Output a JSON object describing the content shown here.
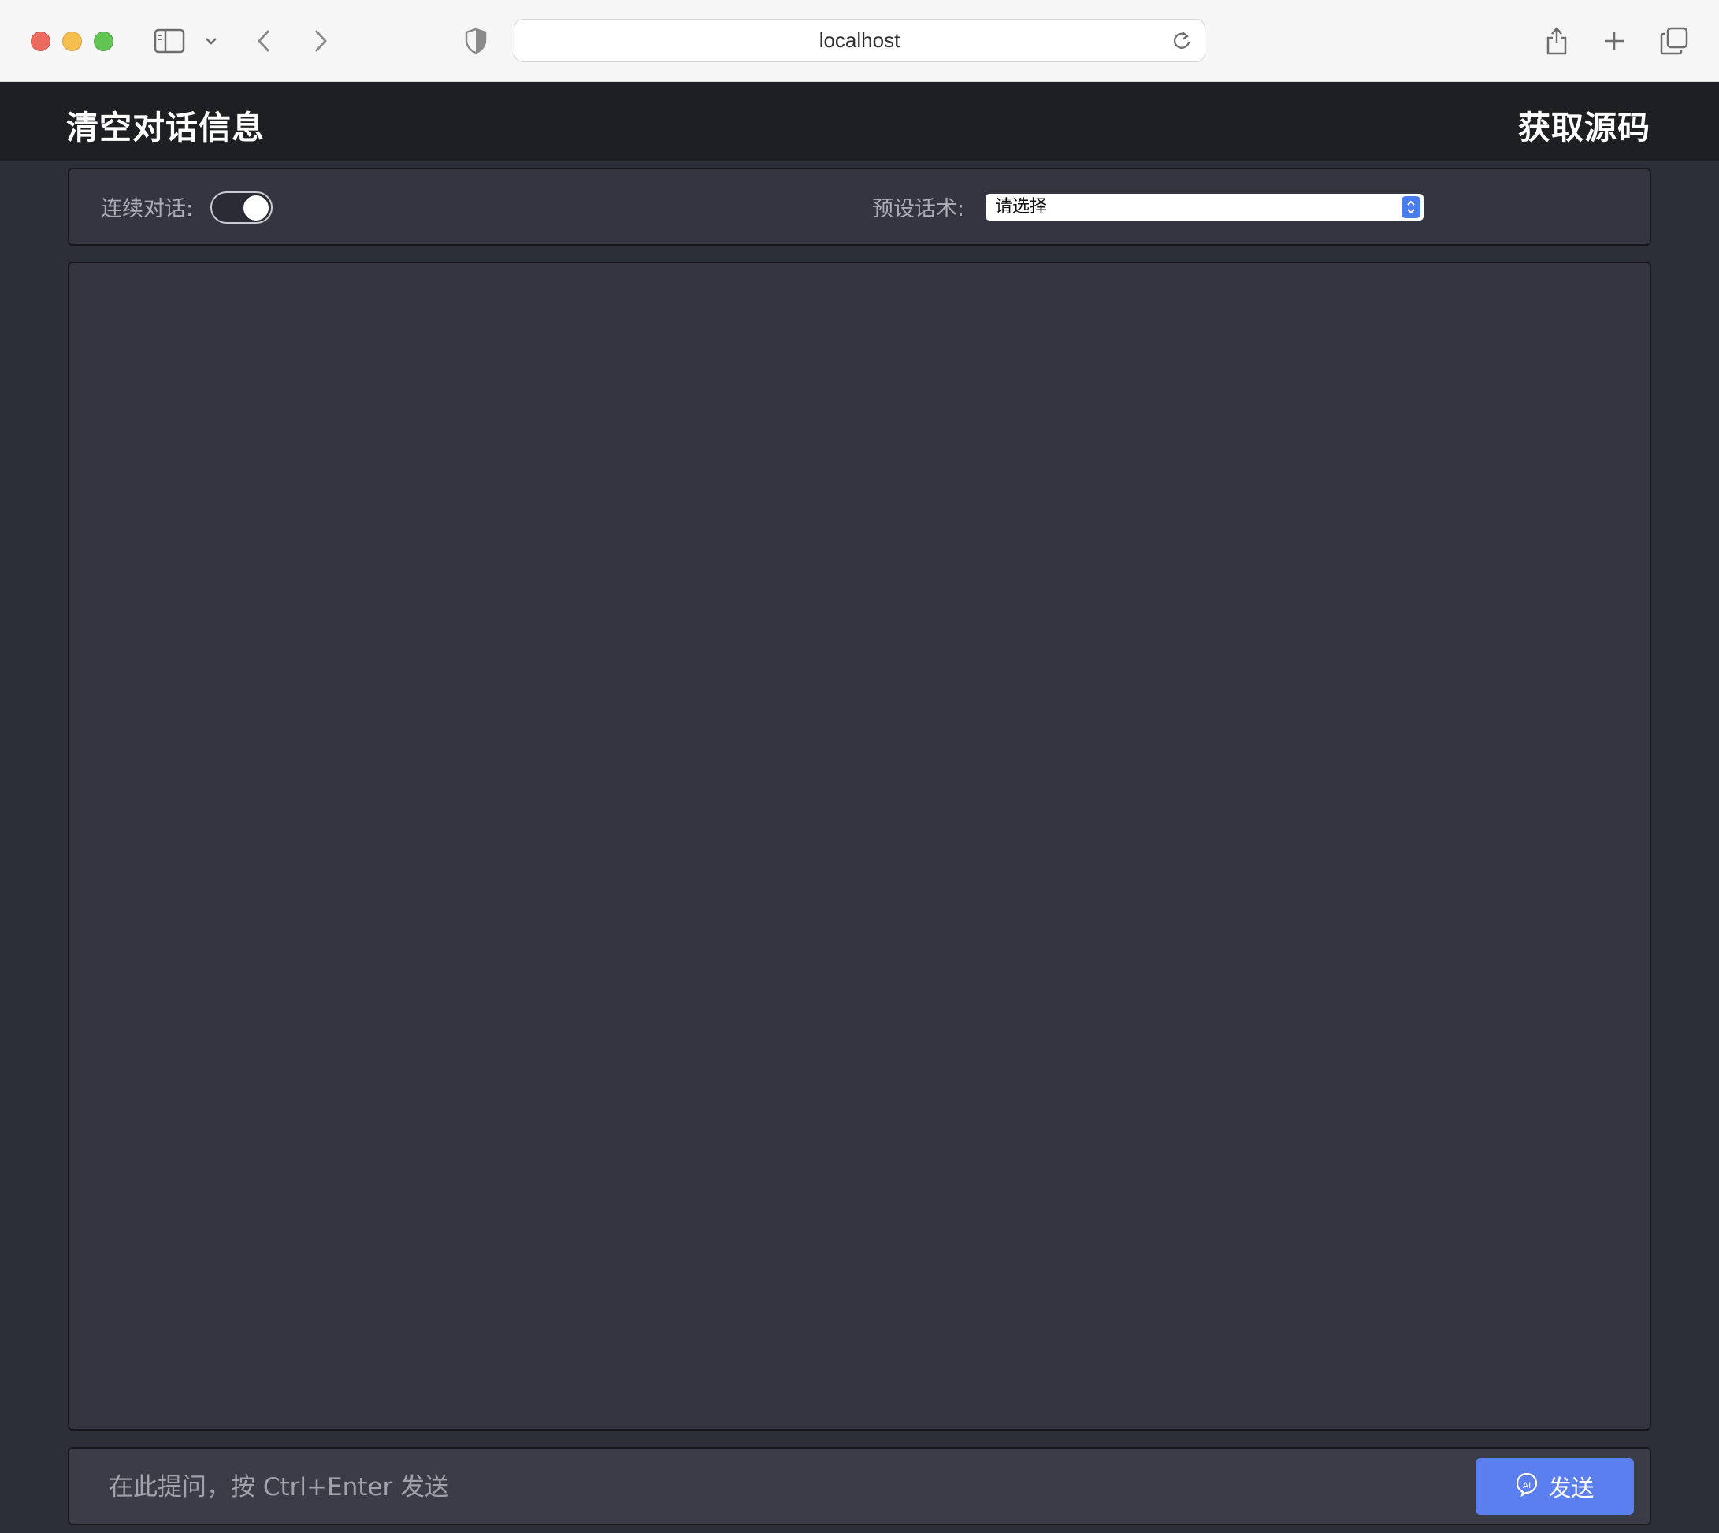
{
  "browser": {
    "url": "localhost",
    "icons": [
      "sidebar-icon",
      "chevron-down-icon",
      "back-icon",
      "forward-icon",
      "shield-icon",
      "reload-icon",
      "share-icon",
      "new-tab-icon",
      "tabs-overview-icon"
    ]
  },
  "header": {
    "clear_label": "清空对话信息",
    "source_label": "获取源码"
  },
  "options": {
    "continuous_label": "连续对话:",
    "continuous_on": true,
    "preset_label": "预设话术:",
    "preset_selected": "请选择"
  },
  "chat": {
    "messages": []
  },
  "input": {
    "placeholder": "在此提问，按 Ctrl+Enter 发送",
    "send_label": "发送"
  },
  "colors": {
    "accent": "#5c7ff0",
    "page_bg": "#2d2f38",
    "panel_bg": "#343541",
    "header_bg": "#1e1f22"
  }
}
